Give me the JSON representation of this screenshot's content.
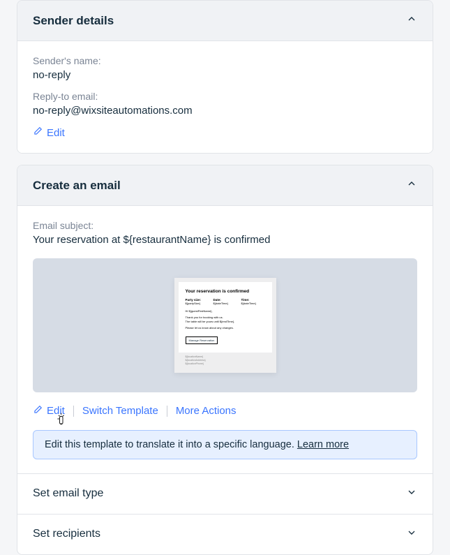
{
  "sender_details": {
    "header_title": "Sender details",
    "sender_name_label": "Sender's name:",
    "sender_name_value": "no-reply",
    "reply_to_label": "Reply-to email:",
    "reply_to_value": "no-reply@wixsiteautomations.com",
    "edit_label": "Edit"
  },
  "create_email": {
    "header_title": "Create an email",
    "subject_label": "Email subject:",
    "subject_value": "Your reservation at ${restaurantName} is confirmed",
    "edit_label": "Edit",
    "switch_template_label": "Switch Template",
    "more_actions_label": "More Actions",
    "banner_text": "Edit this template to translate it into a specific language. ",
    "banner_link": "Learn more"
  },
  "preview": {
    "title": "Your reservation is confirmed",
    "col1_label": "Party size:",
    "col1_value": "${partySize}",
    "col2_label": "Date:",
    "col2_value": "${dateTime}",
    "col3_label": "Time:",
    "col3_value": "${dateTime}",
    "greeting": "Hi ${guestFirstName},",
    "line1": "Thank you for booking with us.",
    "line2": "The table will be yours until ${endTime}.",
    "line3": "Please let us know about any changes.",
    "manage_btn": "Manage Reservation",
    "footer1": "${locationName}",
    "footer2": "${locationAddress}",
    "footer3": "${locationPhone}"
  },
  "collapsed": {
    "set_email_type": "Set email type",
    "set_recipients": "Set recipients"
  }
}
